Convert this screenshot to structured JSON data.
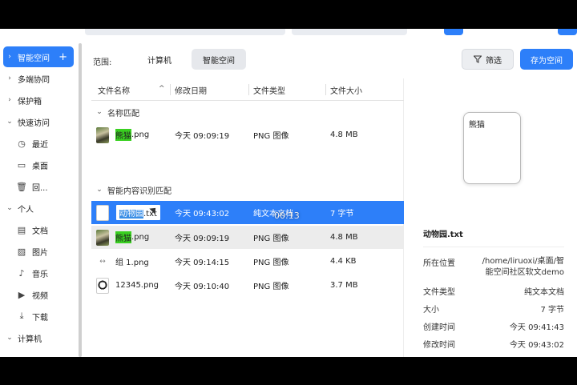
{
  "sidebar": {
    "items": [
      {
        "label": "智能空间",
        "icon": "chevron-right-icon",
        "active": true
      },
      {
        "label": "多端协同",
        "icon": "chevron-right-icon"
      },
      {
        "label": "保护箱",
        "icon": "chevron-right-icon"
      },
      {
        "label": "快速访问",
        "icon": "chevron-down-icon"
      },
      {
        "label": "最近",
        "icon": "clock-icon"
      },
      {
        "label": "桌面",
        "icon": "desktop-icon"
      },
      {
        "label": "回...",
        "icon": "trash-icon"
      },
      {
        "label": "个人",
        "icon": "chevron-down-icon"
      },
      {
        "label": "文档",
        "icon": "document-icon"
      },
      {
        "label": "图片",
        "icon": "image-icon"
      },
      {
        "label": "音乐",
        "icon": "music-icon"
      },
      {
        "label": "视频",
        "icon": "video-icon"
      },
      {
        "label": "下载",
        "icon": "download-icon"
      },
      {
        "label": "计算机",
        "icon": "chevron-down-icon"
      }
    ],
    "plus": "+"
  },
  "scope": {
    "label": "范围:",
    "options": [
      "计算机",
      "智能空间"
    ],
    "selected": "智能空间"
  },
  "toolbar": {
    "filter_label": "筛选",
    "save_label": "存为空间"
  },
  "table": {
    "headers": [
      "文件名称",
      "修改日期",
      "文件类型",
      "文件大小"
    ],
    "sort_arrow": "^",
    "groups": [
      {
        "title": "名称匹配",
        "rows": [
          {
            "name_hl": "熊猫",
            "name_rest": ".png",
            "date": "今天 09:09:19",
            "type": "PNG 图像",
            "size": "4.8 MB"
          }
        ]
      },
      {
        "title": "智能内容识别匹配",
        "rows": [
          {
            "name_sel": "动物园",
            "name_rest": ".txt",
            "date": "今天 09:43:02",
            "type": "纯文本文档",
            "size": "7 字节"
          },
          {
            "name_hl": "熊猫",
            "name_rest": ".png",
            "date": "今天 09:09:19",
            "type": "PNG 图像",
            "size": "4.8 MB"
          },
          {
            "name": "组 1.png",
            "date": "今天 09:14:15",
            "type": "PNG 图像",
            "size": "4.4 KB"
          },
          {
            "name": "12345.png",
            "date": "今天 09:10:40",
            "type": "PNG 图像",
            "size": "3.7 MB"
          }
        ]
      }
    ]
  },
  "details": {
    "preview_text": "熊猫",
    "file_name": "动物园.txt",
    "location_label": "所在位置",
    "location_value": "/home/liruoxi/桌面/智能空间社区软文demo",
    "type_label": "文件类型",
    "type_value": "纯文本文档",
    "size_label": "大小",
    "size_value": "7 字节",
    "created_label": "创建时间",
    "created_value": "今天 09:41:43",
    "modified_label": "修改时间",
    "modified_value": "今天 09:43:02"
  },
  "video": {
    "timer": "00:13"
  }
}
